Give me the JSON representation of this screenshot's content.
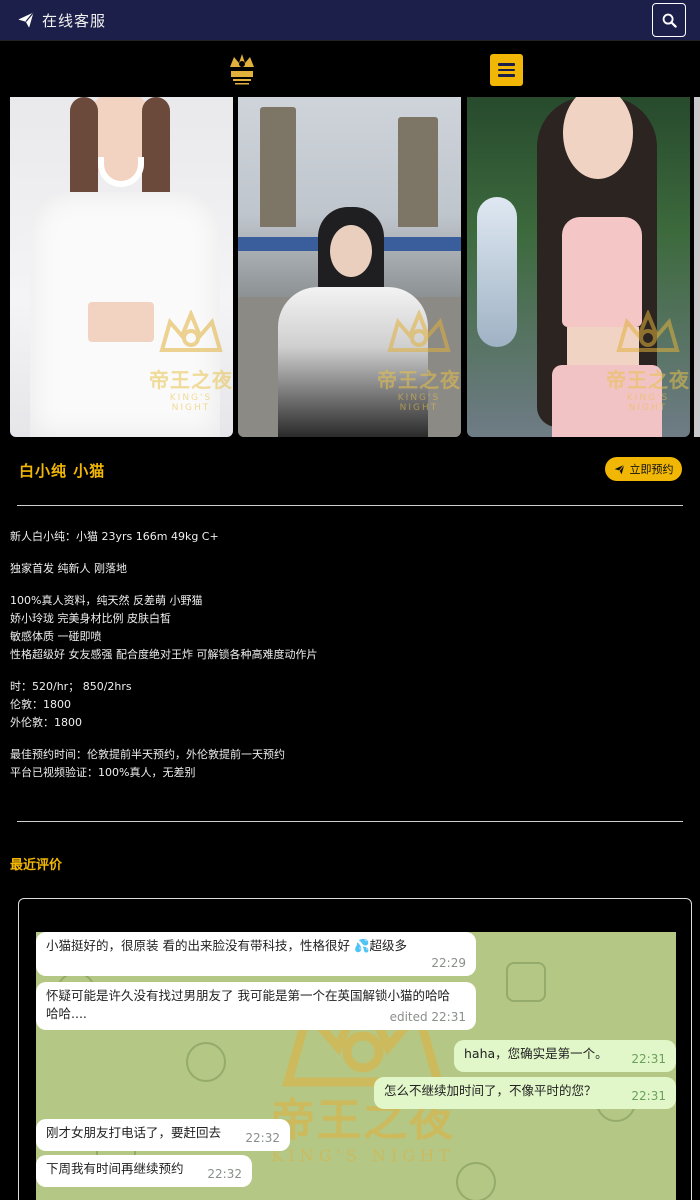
{
  "topbar": {
    "service_label": "在线客服",
    "icon_send": "send-icon",
    "icon_search": "search-icon"
  },
  "header": {
    "logo": "kings-night-logo",
    "menu_icon": "hamburger-icon"
  },
  "gallery": {
    "photos": [
      {
        "alt": "model-photo-white-outfit"
      },
      {
        "alt": "model-photo-tower-bridge"
      },
      {
        "alt": "model-photo-pink-outfit"
      }
    ],
    "watermark_text": "帝王之夜",
    "watermark_sub": "KING'S NIGHT"
  },
  "profile": {
    "title": "白小纯 小猫",
    "book_label": "立即预约",
    "description": [
      "新人白小纯：小猫 23yrs 166m 49kg C+",
      "",
      "独家首发 纯新人 刚落地",
      "",
      "100%真人资料，纯天然 反差萌 小野猫",
      "娇小玲珑 完美身材比例 皮肤白皙",
      "敏感体质 一碰即喷",
      "性格超级好 女友感强 配合度绝对王炸 可解锁各种高难度动作片",
      "",
      "时：520/hr； 850/2hrs",
      "伦敦：1800",
      "外伦敦：1800",
      "",
      "最佳预约时间：伦敦提前半天预约，外伦敦提前一天预约",
      "平台已视频验证：100%真人，无差别"
    ]
  },
  "reviews": {
    "title": "最近评价",
    "watermark_text": "帝王之夜",
    "watermark_sub": "KING'S NIGHT",
    "messages": [
      {
        "text": "小猫挺好的，很原装 看的出来脸没有带科技，性格很好 💦超级多",
        "time": "22:29",
        "dir": "in"
      },
      {
        "text": "怀疑可能是许久没有找过男朋友了 我可能是第一个在英国解锁小猫的哈哈哈哈....",
        "time": "edited 22:31",
        "dir": "in"
      },
      {
        "text": "haha，您确实是第一个。",
        "time": "22:31",
        "dir": "out"
      },
      {
        "text": "怎么不继续加时间了，不像平时的您？",
        "time": "22:31",
        "dir": "out"
      },
      {
        "text": "刚才女朋友打电话了，要赶回去",
        "time": "22:32",
        "dir": "in"
      },
      {
        "text": "下周我有时间再继续预约",
        "time": "22:32",
        "dir": "in"
      }
    ]
  }
}
